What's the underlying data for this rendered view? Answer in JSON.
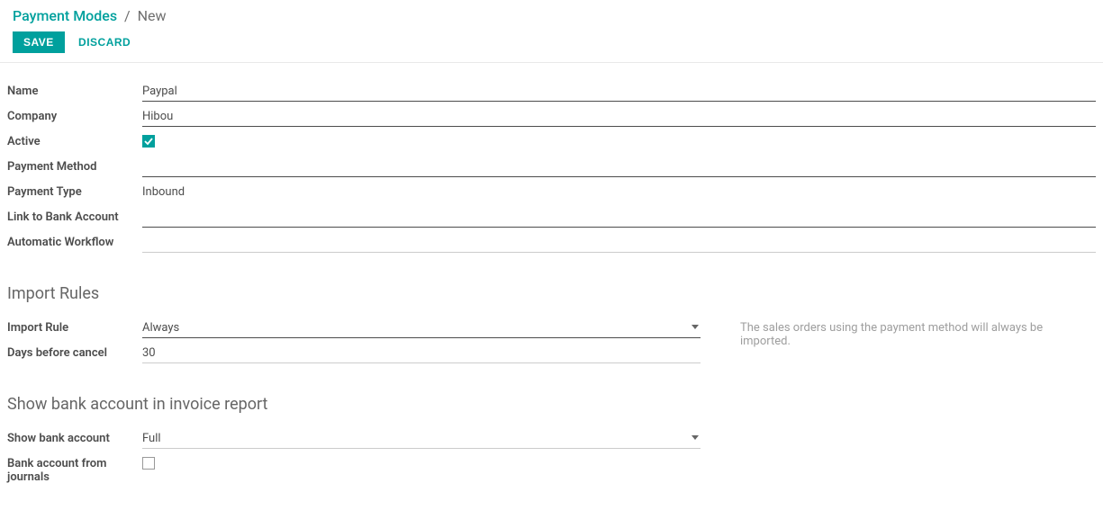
{
  "breadcrumb": {
    "root": "Payment Modes",
    "separator": "/",
    "leaf": "New"
  },
  "buttons": {
    "save": "SAVE",
    "discard": "DISCARD"
  },
  "labels": {
    "name": "Name",
    "company": "Company",
    "active": "Active",
    "payment_method": "Payment Method",
    "payment_type": "Payment Type",
    "link_bank_account": "Link to Bank Account",
    "automatic_workflow": "Automatic Workflow",
    "import_rule": "Import Rule",
    "days_before_cancel": "Days before cancel",
    "show_bank_account": "Show bank account",
    "bank_account_from_journals": "Bank account from journals"
  },
  "values": {
    "name": "Paypal",
    "company": "Hibou",
    "payment_method": "",
    "payment_type": "Inbound",
    "link_bank_account": "",
    "automatic_workflow": "",
    "import_rule": "Always",
    "days_before_cancel": "30",
    "show_bank_account": "Full"
  },
  "checks": {
    "active": true,
    "bank_account_from_journals": false
  },
  "sections": {
    "import_rules": "Import Rules",
    "show_bank": "Show bank account in invoice report"
  },
  "helper": {
    "import_rule": "The sales orders using the payment method will always be imported."
  }
}
